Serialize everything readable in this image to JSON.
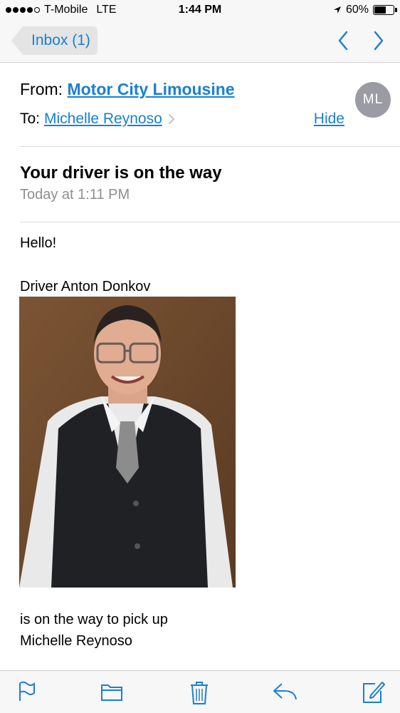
{
  "status_bar": {
    "carrier": "T-Mobile",
    "network": "LTE",
    "time": "1:44 PM",
    "battery": "60%",
    "battery_level": 0.6,
    "signal_bars_filled": 4,
    "signal_bars_total": 5
  },
  "nav": {
    "back_label": "Inbox (1)",
    "prev_icon": "chevron-up-icon",
    "next_icon": "chevron-down-icon",
    "accent_color": "#1a7fd4"
  },
  "header": {
    "from_label": "From:",
    "from_name": "Motor City Limousine",
    "to_label": "To:",
    "to_name": "Michelle Reynoso",
    "hide_label": "Hide",
    "avatar_initials": "ML"
  },
  "message": {
    "subject": "Your driver is on the way",
    "date": "Today at 1:11 PM",
    "greeting": "Hello!",
    "driver_line": "Driver Anton Donkov",
    "closing_line1": "is on the way to pick up",
    "closing_line2": "Michelle Reynoso"
  },
  "toolbar": {
    "icons": [
      "flag-icon",
      "folder-icon",
      "trash-icon",
      "reply-icon",
      "compose-icon"
    ]
  }
}
